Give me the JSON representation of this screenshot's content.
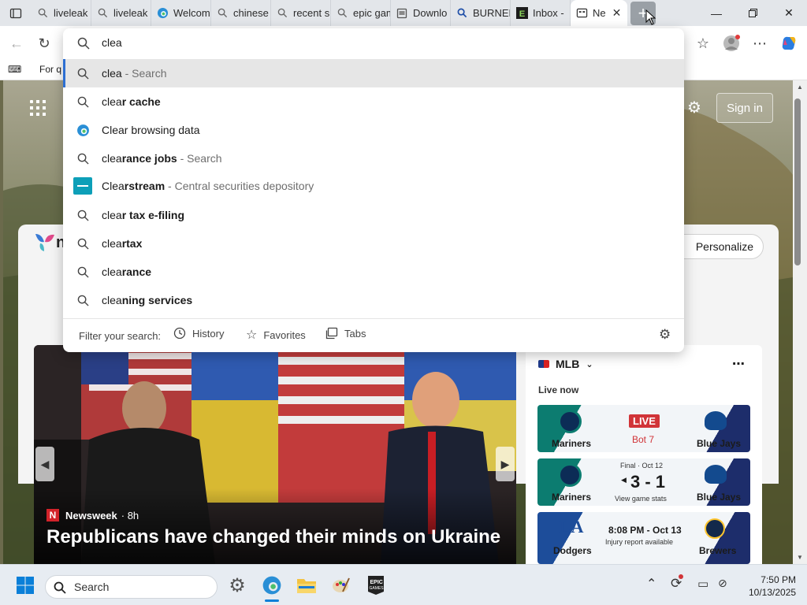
{
  "tabs": [
    {
      "label": "liveleak",
      "icon": "search-icon"
    },
    {
      "label": "liveleak",
      "icon": "search-icon"
    },
    {
      "label": "Welcom",
      "icon": "edge-icon"
    },
    {
      "label": "chinese",
      "icon": "search-icon"
    },
    {
      "label": "recent s",
      "icon": "search-icon"
    },
    {
      "label": "epic gam",
      "icon": "search-icon"
    },
    {
      "label": "Downlo",
      "icon": "page-icon"
    },
    {
      "label": "BURNER",
      "icon": "search-icon"
    },
    {
      "label": "Inbox -",
      "icon": "e-logo-icon"
    },
    {
      "label": "Ne",
      "icon": "newtab-icon",
      "active": true
    }
  ],
  "favbar": {
    "item": "For q"
  },
  "omnibox": {
    "query": "clea",
    "suggestions": [
      {
        "prefix": "clea",
        "bold": "",
        "suffix": " - Search",
        "icon": "search-icon",
        "selected": true
      },
      {
        "prefix": "clea",
        "bold": "r cache",
        "suffix": "",
        "icon": "search-icon"
      },
      {
        "prefix": "Clear browsing data",
        "bold": "",
        "suffix": "",
        "icon": "edge-icon"
      },
      {
        "prefix": "clea",
        "bold": "rance jobs",
        "suffix": " - Search",
        "icon": "search-icon"
      },
      {
        "prefix": "Clea",
        "bold": "rstream",
        "suffix": " - Central securities depository",
        "icon": "clearstream-logo-icon"
      },
      {
        "prefix": "clea",
        "bold": "r tax e-filing",
        "suffix": "",
        "icon": "search-icon"
      },
      {
        "prefix": "clea",
        "bold": "rtax",
        "suffix": "",
        "icon": "search-icon"
      },
      {
        "prefix": "clea",
        "bold": "rance",
        "suffix": "",
        "icon": "search-icon"
      },
      {
        "prefix": "clea",
        "bold": "ning services",
        "suffix": "",
        "icon": "search-icon"
      }
    ],
    "filter": {
      "label": "Filter your search:",
      "history": "History",
      "favorites": "Favorites",
      "tabs": "Tabs"
    }
  },
  "page": {
    "signin": "Sign in",
    "personalize": "Personalize",
    "news": {
      "source": "Newsweek",
      "age": "· 8h",
      "headline": "Republicans have changed their minds on Ukraine"
    },
    "mlb": {
      "title": "MLB",
      "live_now": "Live now",
      "games": [
        {
          "home": "Mariners",
          "away": "Blue Jays",
          "status": "LIVE",
          "detail": "Bot 7"
        },
        {
          "home": "Mariners",
          "away": "Blue Jays",
          "status": "Final · Oct 12",
          "score": "3 - 1",
          "detail": "View game stats"
        },
        {
          "home": "Dodgers",
          "away": "Brewers",
          "status": "8:08 PM - Oct 13",
          "detail": "Injury report available"
        }
      ]
    }
  },
  "taskbar": {
    "search_placeholder": "Search",
    "time": "7:50 PM",
    "date": "10/13/2025"
  },
  "colors": {
    "accent": "#2d6fd2",
    "live_red": "#d13438",
    "mariners_teal": "#0c7c70",
    "bluejays_navy": "#1d2d6b"
  }
}
